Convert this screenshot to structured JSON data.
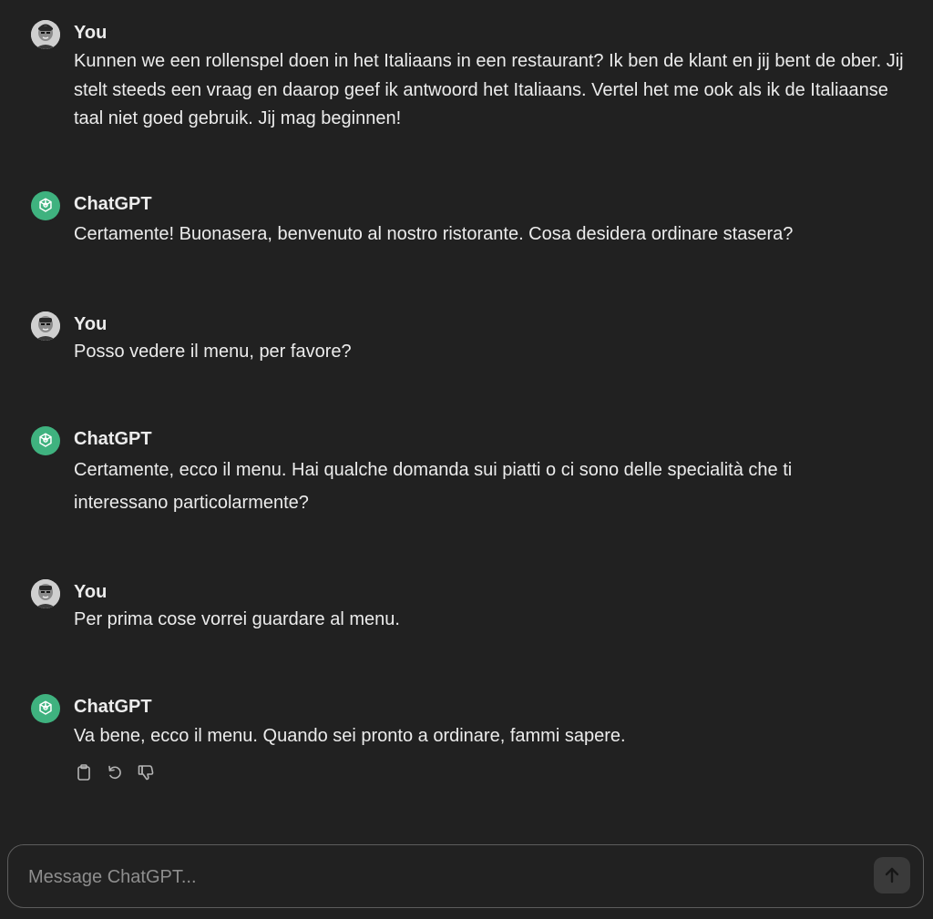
{
  "composer": {
    "placeholder": "Message ChatGPT..."
  },
  "messages": [
    {
      "author": "You",
      "role": "user",
      "text": "Kunnen we een rollenspel doen in het Italiaans in een restaurant? Ik ben de klant en jij bent de ober. Jij stelt steeds een vraag en daarop geef ik antwoord het Italiaans. Vertel het me ook als ik de Italiaanse taal niet goed gebruik. Jij mag beginnen!"
    },
    {
      "author": "ChatGPT",
      "role": "assistant",
      "text": "Certamente! Buonasera, benvenuto al nostro ristorante. Cosa desidera ordinare stasera?"
    },
    {
      "author": "You",
      "role": "user",
      "text": "Posso vedere il menu, per favore?"
    },
    {
      "author": "ChatGPT",
      "role": "assistant",
      "text": "Certamente, ecco il menu. Hai qualche domanda sui piatti o ci sono delle specialità che ti interessano particolarmente?"
    },
    {
      "author": "You",
      "role": "user",
      "text": "Per prima cose vorrei guardare al menu."
    },
    {
      "author": "ChatGPT",
      "role": "assistant",
      "text": "Va bene, ecco il menu. Quando sei pronto a ordinare, fammi sapere."
    }
  ],
  "icons": {
    "user_avatar": "user-avatar",
    "assistant_avatar": "chatgpt-logo-icon",
    "copy": "clipboard-icon",
    "regenerate": "regenerate-icon",
    "dislike": "thumbs-down-icon",
    "send": "arrow-up-icon"
  },
  "colors": {
    "background": "#212121",
    "assistant_avatar": "#3fb27f",
    "text": "#ececec",
    "placeholder": "#8e8e8e",
    "composer_border": "#5d5d5d"
  }
}
